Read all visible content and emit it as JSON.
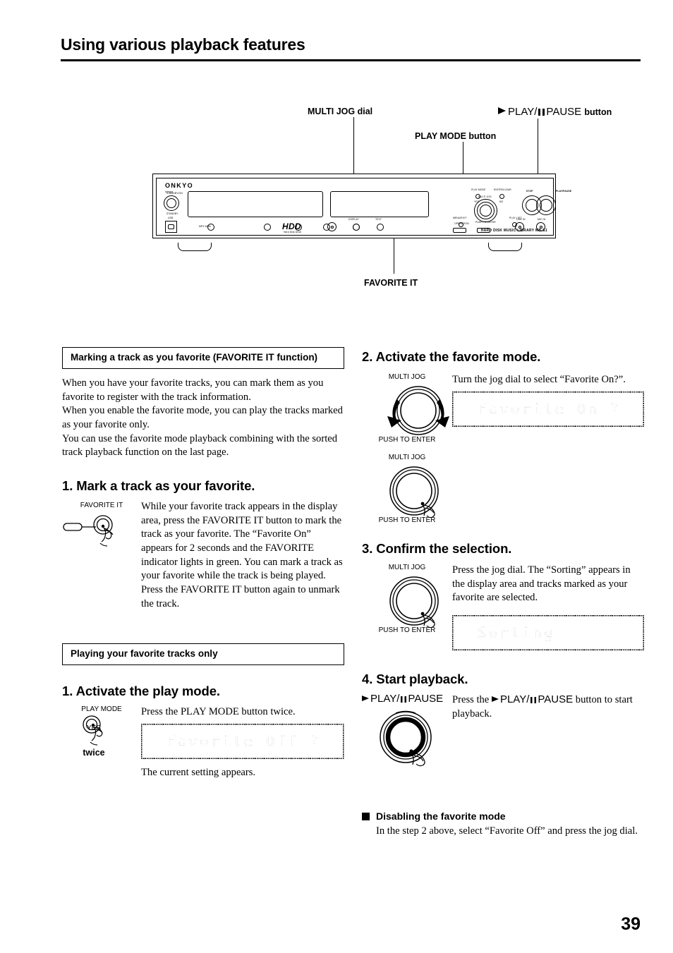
{
  "page": {
    "title": "Using various playback features",
    "number": "39"
  },
  "diagram": {
    "labels": {
      "multi_jog_dial": "MULTI JOG dial",
      "play_mode_button": "PLAY MODE button",
      "play_pause_button_pre": "PLAY/",
      "play_pause_button_post": "PAUSE",
      "play_pause_button_suffix": "button",
      "favorite_it": "FAVORITE IT"
    },
    "device": {
      "brand": "ONKYO",
      "brand_sub": "Integra",
      "standby_top": "STANDBY/ON",
      "standby_bottom": "STANDBY",
      "usb": "USB",
      "hdd_logo": "HDD",
      "hdd_sub": "Hard Disk Drive",
      "model": "HARD DISK MUSIC LIBRARY  MB-S1",
      "panel_buttons": [
        "DISPLAY",
        "TEXT",
        "CD DUBBING",
        "FAVORITE IT",
        "REC MODE",
        "REC MODE",
        "EXTERNAL INPUT"
      ],
      "jog_labels": {
        "play_mode": "PLAY MODE",
        "yes": "YES",
        "enter_clear": "ENTER/CLEAR",
        "no": "NO",
        "multi_jog": "MULTI JOG",
        "push_to_enter": "PUSH TO ENTER",
        "menu_exit": "MENU/EXIT",
        "play_list": "PLAY LIST",
        "stop": "STOP",
        "play_pause": "PLAY/PAUSE",
        "operation": "OPERATION",
        "prev": "PREV",
        "next": "NEXT",
        "line_in": "LINE IN",
        "mic_in": "MIC IN"
      }
    }
  },
  "left_column": {
    "section1": {
      "heading": "Marking a track as you favorite (FAVORITE IT function)",
      "paragraphs": [
        "When you have your favorite tracks, you can mark them as you favorite to register with the track information.",
        "When you enable the favorite mode, you can play the tracks marked as your favorite only.",
        "You can use the favorite mode playback combining with the sorted track playback function on the last page."
      ]
    },
    "step1": {
      "heading": "1. Mark a track as your favorite.",
      "art_caption": "FAVORITE IT",
      "body": "While your favorite track appears in the display area, press the FAVORITE IT button to mark the track as your favorite. The “Favorite On” appears for 2 seconds and the FAVORITE indicator lights in green. You can mark a track as your favorite while the track is being played. Press the FAVORITE IT button again to unmark the track."
    },
    "section2": {
      "heading": "Playing your favorite tracks only"
    },
    "step2": {
      "heading": "1. Activate the play mode.",
      "art_caption_top": "PLAY MODE",
      "art_caption_mid": "YES",
      "art_caption_bottom": "twice",
      "instruction": "Press the PLAY MODE button twice.",
      "lcd": "Favorite Off ?",
      "note": "The current setting appears."
    }
  },
  "right_column": {
    "step2": {
      "heading": "2. Activate the favorite mode.",
      "art_caption_top": "MULTI JOG",
      "art_caption_bottom": "PUSH TO ENTER",
      "instruction": "Turn the jog dial to select “Favorite On?”.",
      "lcd": "Favorite On ?",
      "art2_caption_top": "MULTI JOG",
      "art2_caption_bottom": "PUSH TO ENTER"
    },
    "step3": {
      "heading": "3. Confirm the selection.",
      "art_caption_top": "MULTI JOG",
      "art_caption_bottom": "PUSH TO ENTER",
      "instruction": "Press the jog dial. The “Sorting” appears in the display area and tracks marked as your favorite are selected.",
      "lcd": "Sorting"
    },
    "step4": {
      "heading": "4. Start playback.",
      "art_caption_pre": "PLAY/",
      "art_caption_post": "PAUSE",
      "instruction_pre": "Press the",
      "instruction_mid": "PLAY/",
      "instruction_mid2": "PAUSE",
      "instruction_post": "button to start playback."
    },
    "note": {
      "heading": "Disabling the favorite mode",
      "body": "In the step 2 above, select “Favorite Off” and press the jog dial."
    }
  }
}
